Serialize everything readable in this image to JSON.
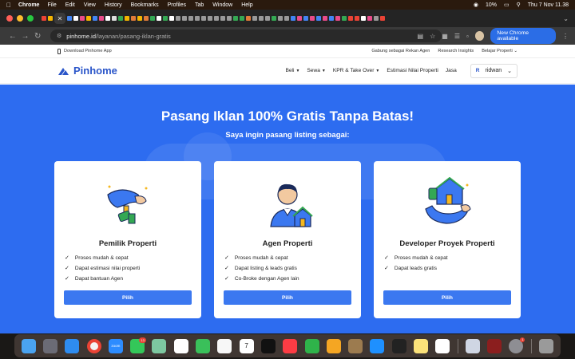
{
  "menubar": {
    "apple_icon": "apple-icon",
    "app_name": "Chrome",
    "items": [
      "File",
      "Edit",
      "View",
      "History",
      "Bookmarks",
      "Profiles",
      "Tab",
      "Window",
      "Help"
    ],
    "battery": "10%",
    "clock": "Thu 7 Nov  11.38"
  },
  "browser": {
    "url_host": "pinhome.id",
    "url_path": "/layanan/pasang-iklan-gratis",
    "new_chrome_label": "New Chrome available"
  },
  "site": {
    "download_app": "Download Pinhome App",
    "top_links": [
      "Gabung sebagai Rekan Agen",
      "Research Insights",
      "Belajar Properti"
    ],
    "logo_text": "Pinhome",
    "nav": [
      {
        "label": "Beli",
        "caret": true
      },
      {
        "label": "Sewa",
        "caret": true
      },
      {
        "label": "KPR & Take Over",
        "caret": true
      },
      {
        "label": "Estimasi Nilai Properti",
        "caret": false
      },
      {
        "label": "Jasa",
        "caret": false
      }
    ],
    "user_initial": "R",
    "user_name": "ridwan"
  },
  "hero": {
    "title": "Pasang Iklan 100% Gratis Tanpa Batas!",
    "subtitle": "Saya ingin pasang listing sebagai:"
  },
  "cards": [
    {
      "title": "Pemilik Properti",
      "features": [
        "Proses mudah & cepat",
        "Dapat estimasi nilai properti",
        "Dapat bantuan Agen"
      ],
      "button": "Pilih",
      "icon": "hand-key-icon"
    },
    {
      "title": "Agen Properti",
      "features": [
        "Proses mudah & cepat",
        "Dapat listing & leads gratis",
        "Co-Broke dengan Agen lain"
      ],
      "button": "Pilih",
      "icon": "agent-house-icon"
    },
    {
      "title": "Developer Proyek Properti",
      "features": [
        "Proses mudah & cepat",
        "Dapat leads gratis"
      ],
      "button": "Pilih",
      "icon": "hand-house-icon"
    }
  ],
  "dock": {
    "apps": [
      "finder-icon",
      "launchpad-icon",
      "safari-icon",
      "chrome-icon",
      "zoom-icon",
      "messages-icon",
      "maps-icon",
      "photos-icon",
      "facetime-icon",
      "reminders-icon",
      "calendar-icon",
      "appletv-icon",
      "music-icon",
      "numbers-icon",
      "pages-icon",
      "preview-icon",
      "appstore-icon",
      "figma-icon",
      "notes-icon",
      "freeform-icon",
      "screenshot-icon",
      "dictionary-icon",
      "settings-icon",
      "trash-icon"
    ],
    "calendar_day": "7",
    "zoom_label": "zoom",
    "messages_badge": "13",
    "settings_badge": "1"
  }
}
